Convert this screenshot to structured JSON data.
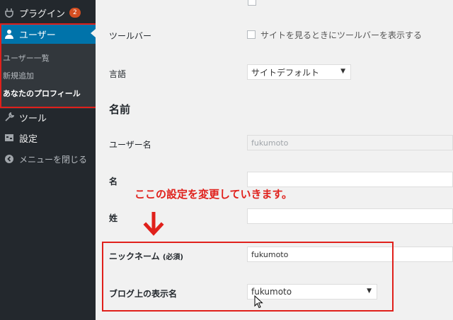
{
  "sidebar": {
    "plugins": {
      "label": "プラグイン",
      "badge": "2",
      "icon": "plug-icon"
    },
    "users": {
      "label": "ユーザー",
      "icon": "user-icon"
    },
    "submenu": [
      "ユーザー一覧",
      "新規追加",
      "あなたのプロフィール"
    ],
    "tools": {
      "label": "ツール",
      "icon": "wrench-icon"
    },
    "settings": {
      "label": "設定",
      "icon": "settings-icon"
    },
    "collapse": {
      "label": "メニューを閉じる",
      "icon": "collapse-icon"
    }
  },
  "form": {
    "toolbar_label": "ツールバー",
    "toolbar_checkbox": "サイトを見るときにツールバーを表示する",
    "language_label": "言語",
    "language_value": "サイトデフォルト",
    "name_heading": "名前",
    "username_label": "ユーザー名",
    "username_value": "fukumoto",
    "firstname_label": "名",
    "lastname_label": "姓",
    "nickname_label": "ニックネーム",
    "nickname_required": "(必須)",
    "nickname_value": "fukumoto",
    "display_name_label": "ブログ上の表示名",
    "display_name_value": "fukumoto"
  },
  "annotation": "ここの設定を変更していきます。",
  "colors": {
    "accent": "#0073aa",
    "highlight": "#e0201b",
    "sidebar": "#23282d"
  }
}
